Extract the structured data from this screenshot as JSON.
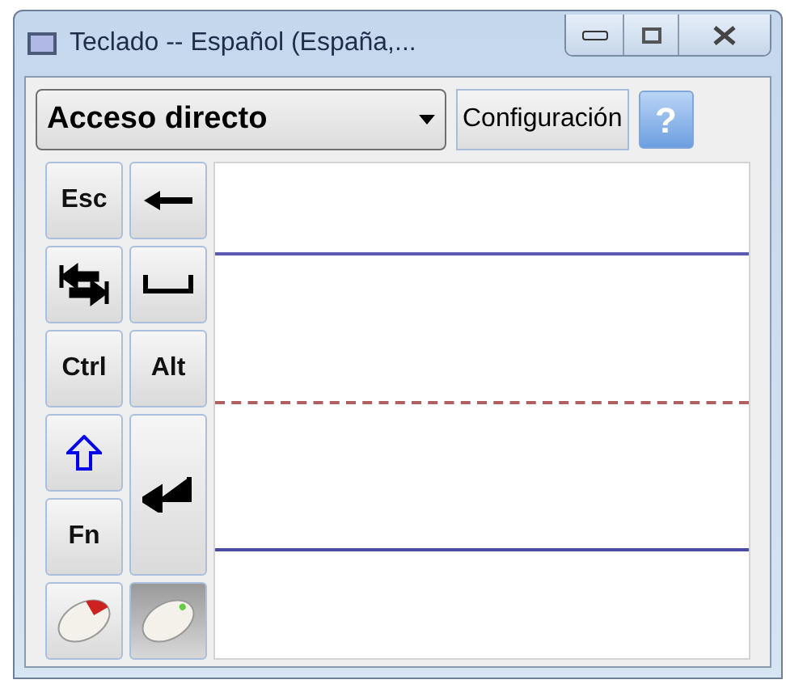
{
  "window": {
    "title": "Teclado -- Español (España,..."
  },
  "toolbar": {
    "mode_dropdown": {
      "value": "Acceso directo"
    },
    "settings_button": {
      "label": "Configuración"
    },
    "help_button": {
      "label": "?"
    }
  },
  "keys": [
    {
      "kind": "text",
      "label": "Esc",
      "selected": false
    },
    {
      "kind": "backspace",
      "selected": false
    },
    {
      "kind": "tab",
      "selected": false
    },
    {
      "kind": "space",
      "selected": false
    },
    {
      "kind": "text",
      "label": "Ctrl",
      "selected": false
    },
    {
      "kind": "text",
      "label": "Alt",
      "selected": false
    },
    {
      "kind": "shift",
      "selected": false
    },
    {
      "kind": "enter",
      "selected": false
    },
    {
      "kind": "text",
      "label": "Fn",
      "selected": false
    },
    {
      "kind": "left-click",
      "selected": false
    },
    {
      "kind": "right-click",
      "selected": true
    }
  ]
}
